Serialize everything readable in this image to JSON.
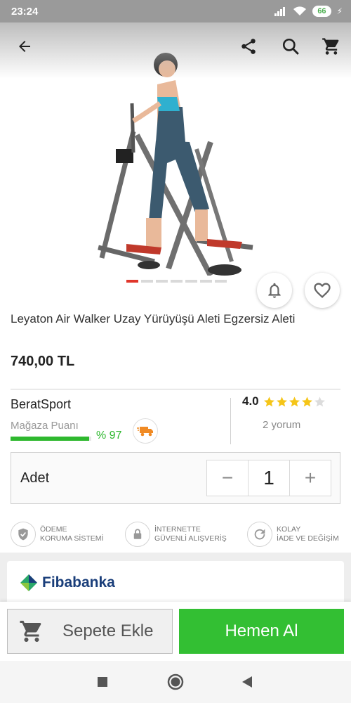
{
  "status_bar": {
    "time": "23:24",
    "battery": "66"
  },
  "product": {
    "title": "Leyaton Air Walker Uzay Yürüyüşü Aleti Egzersiz Aleti",
    "price": "740,00 TL",
    "image_count": 7,
    "active_image_index": 0
  },
  "seller": {
    "name": "BeratSport",
    "score_label": "Mağaza Puanı",
    "score_percent": "% 97",
    "score_value": 0.97
  },
  "rating": {
    "value": "4.0",
    "stars_filled": 4,
    "stars_total": 5,
    "reviews": "2 yorum"
  },
  "quantity": {
    "label": "Adet",
    "value": "1",
    "minus": "−",
    "plus": "+"
  },
  "features": [
    {
      "icon": "shield-check-icon",
      "line1": "ÖDEME",
      "line2": "KORUMA SİSTEMİ"
    },
    {
      "icon": "lock-icon",
      "line1": "İNTERNETTE",
      "line2": "GÜVENLİ ALIŞVERİŞ"
    },
    {
      "icon": "refresh-icon",
      "line1": "KOLAY",
      "line2": "İADE VE DEĞİŞİM"
    }
  ],
  "bank": {
    "name": "Fibabanka"
  },
  "actions": {
    "add_to_cart": "Sepete Ekle",
    "buy_now": "Hemen Al"
  },
  "colors": {
    "accent_green": "#33bf33",
    "active_dot": "#e0362b",
    "star": "#f5c518",
    "bank_blue": "#1a3e7a"
  }
}
